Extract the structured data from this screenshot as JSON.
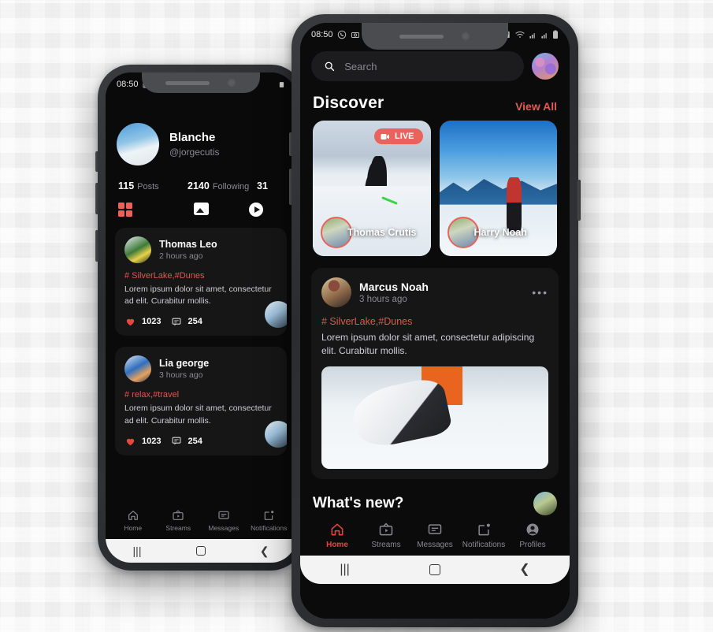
{
  "background": {
    "color": "#f4f4f4",
    "pattern": "mosaic-tiles"
  },
  "left_phone": {
    "status": {
      "time": "08:50",
      "icons": [
        "image-icon",
        "whatsapp-icon",
        "alarm-icon"
      ]
    },
    "profile": {
      "name": "Blanche",
      "handle": "@jorgecutis",
      "stats": [
        {
          "value": "115",
          "label": "Posts"
        },
        {
          "value": "2140",
          "label": "Following"
        },
        {
          "value": "31",
          "label": ""
        }
      ],
      "tabs": [
        "grid-icon",
        "image-icon",
        "play-icon"
      ]
    },
    "posts": [
      {
        "author": "Thomas Leo",
        "time": "2 hours ago",
        "tags": "# SilverLake,#Dunes",
        "text": "Lorem ipsum dolor sit amet, consectetur ad elit. Curabitur mollis.",
        "likes": "1023",
        "comments": "254"
      },
      {
        "author": "Lia george",
        "time": "3 hours ago",
        "tags": "# relax,#travel",
        "text": "Lorem ipsum dolor sit amet, consectetur ad elit. Curabitur mollis.",
        "likes": "1023",
        "comments": "254"
      }
    ],
    "bottom_nav": [
      {
        "label": "Home",
        "icon": "home-icon",
        "active": false
      },
      {
        "label": "Streams",
        "icon": "tv-icon",
        "active": false
      },
      {
        "label": "Messages",
        "icon": "chat-icon",
        "active": false
      },
      {
        "label": "Notifications",
        "icon": "bell-square-icon",
        "active": false
      }
    ],
    "system_bar": [
      "recents-icon",
      "home-circle-icon",
      "back-icon"
    ]
  },
  "right_phone": {
    "status": {
      "time": "08:50",
      "icons": [
        "whatsapp-icon",
        "camera-icon",
        "alarm-icon",
        "wifi-icon",
        "signal-icon",
        "signal-icon",
        "battery-icon"
      ]
    },
    "search": {
      "placeholder": "Search",
      "value": ""
    },
    "header_avatar": "user-avatar",
    "discover": {
      "title": "Discover",
      "view_all": "View All",
      "cards": [
        {
          "name": "Thomas Crutis",
          "live": true,
          "live_label": "LIVE"
        },
        {
          "name": "Harry Noah",
          "live": false,
          "live_label": ""
        }
      ]
    },
    "post": {
      "author": "Marcus Noah",
      "time": "3 hours ago",
      "tags": "# SilverLake,#Dunes",
      "text": "Lorem ipsum dolor sit amet, consectetur adipiscing elit. Curabitur mollis.",
      "more": "•••"
    },
    "whats_new": {
      "title": "What's new?"
    },
    "bottom_nav": [
      {
        "label": "Home",
        "icon": "home-icon",
        "active": true
      },
      {
        "label": "Streams",
        "icon": "tv-icon",
        "active": false
      },
      {
        "label": "Messages",
        "icon": "chat-icon",
        "active": false
      },
      {
        "label": "Notifications",
        "icon": "bell-square-icon",
        "active": false
      },
      {
        "label": "Profiles",
        "icon": "person-circle-icon",
        "active": false
      }
    ],
    "system_bar": [
      "recents-icon",
      "home-circle-icon",
      "back-icon"
    ]
  },
  "colors": {
    "accent": "#e0453c",
    "tag": "#e0584f",
    "card": "#161617",
    "bg": "#0b0b0c"
  }
}
